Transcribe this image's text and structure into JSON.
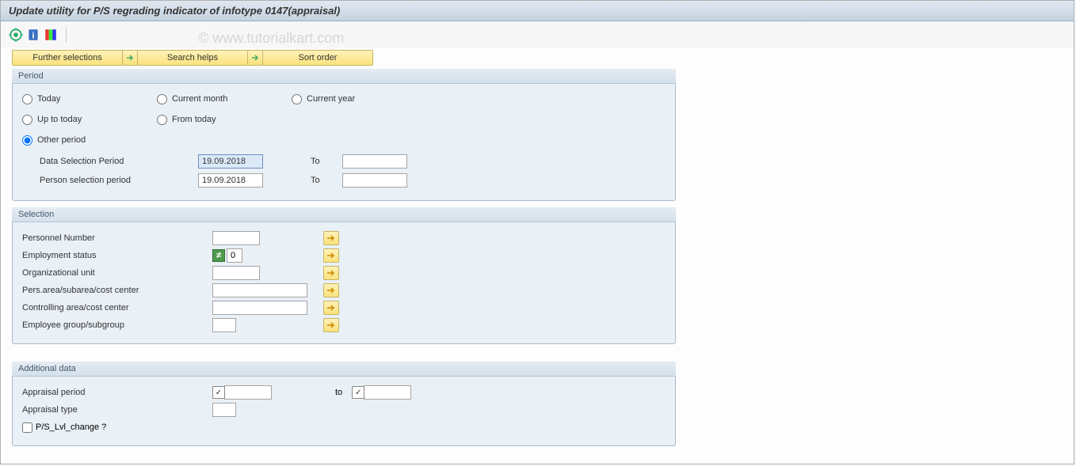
{
  "title": "Update utility for P/S regrading indicator of infotype 0147(appraisal)",
  "watermark": "© www.tutorialkart.com",
  "toolbar": {
    "execute_icon": "execute-icon",
    "info_icon": "info-icon",
    "color_icon": "color-legend-icon"
  },
  "buttons": {
    "further_selections": "Further selections",
    "search_helps": "Search helps",
    "sort_order": "Sort order"
  },
  "period": {
    "title": "Period",
    "radios": {
      "today": "Today",
      "current_month": "Current month",
      "current_year": "Current year",
      "up_to_today": "Up to today",
      "from_today": "From today",
      "other_period": "Other period"
    },
    "selected": "other_period",
    "data_selection_label": "Data Selection Period",
    "data_selection_from": "19.09.2018",
    "data_selection_to": "",
    "person_selection_label": "Person selection period",
    "person_selection_from": "19.09.2018",
    "person_selection_to": "",
    "to_label": "To"
  },
  "selection": {
    "title": "Selection",
    "personnel_number": {
      "label": "Personnel Number",
      "value": ""
    },
    "employment_status": {
      "label": "Employment status",
      "value": "0",
      "neq": true
    },
    "org_unit": {
      "label": "Organizational unit",
      "value": ""
    },
    "pers_area": {
      "label": "Pers.area/subarea/cost center",
      "value": ""
    },
    "controlling_area": {
      "label": "Controlling area/cost center",
      "value": ""
    },
    "employee_group": {
      "label": "Employee group/subgroup",
      "value": ""
    }
  },
  "additional": {
    "title": "Additional data",
    "appraisal_period": {
      "label": "Appraisal period",
      "from_check": true,
      "from_value": "",
      "to_label": "to",
      "to_check": true,
      "to_value": ""
    },
    "appraisal_type": {
      "label": "Appraisal type",
      "value": ""
    },
    "ps_lvl": {
      "label": "P/S_Lvl_change ?",
      "checked": false
    }
  }
}
